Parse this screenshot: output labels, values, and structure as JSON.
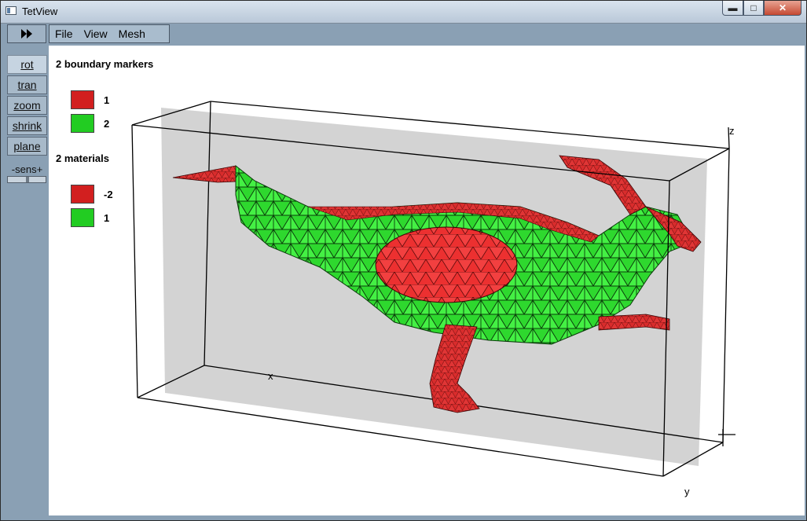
{
  "window": {
    "title": "TetView"
  },
  "menu": {
    "items": [
      "File",
      "View",
      "Mesh"
    ]
  },
  "toolbar": {
    "buttons": [
      {
        "label": "rot",
        "active": true
      },
      {
        "label": "tran",
        "active": false
      },
      {
        "label": "zoom",
        "active": false
      },
      {
        "label": "shrink",
        "active": false
      },
      {
        "label": "plane",
        "active": false
      }
    ],
    "sensitivity_label": "-sens+"
  },
  "legend": {
    "boundary_title": "2 boundary markers",
    "boundary_items": [
      {
        "label": "1",
        "color": "#d21f1f"
      },
      {
        "label": "2",
        "color": "#22cc22"
      }
    ],
    "materials_title": "2 materials",
    "material_items": [
      {
        "label": "-2",
        "color": "#d21f1f"
      },
      {
        "label": "1",
        "color": "#22cc22"
      }
    ]
  },
  "axes": {
    "x": "x",
    "y": "y",
    "z": "z"
  },
  "colors": {
    "mesh_red": "#e23a3a",
    "mesh_green": "#33ee33",
    "plane_gray": "#d3d3d3"
  }
}
